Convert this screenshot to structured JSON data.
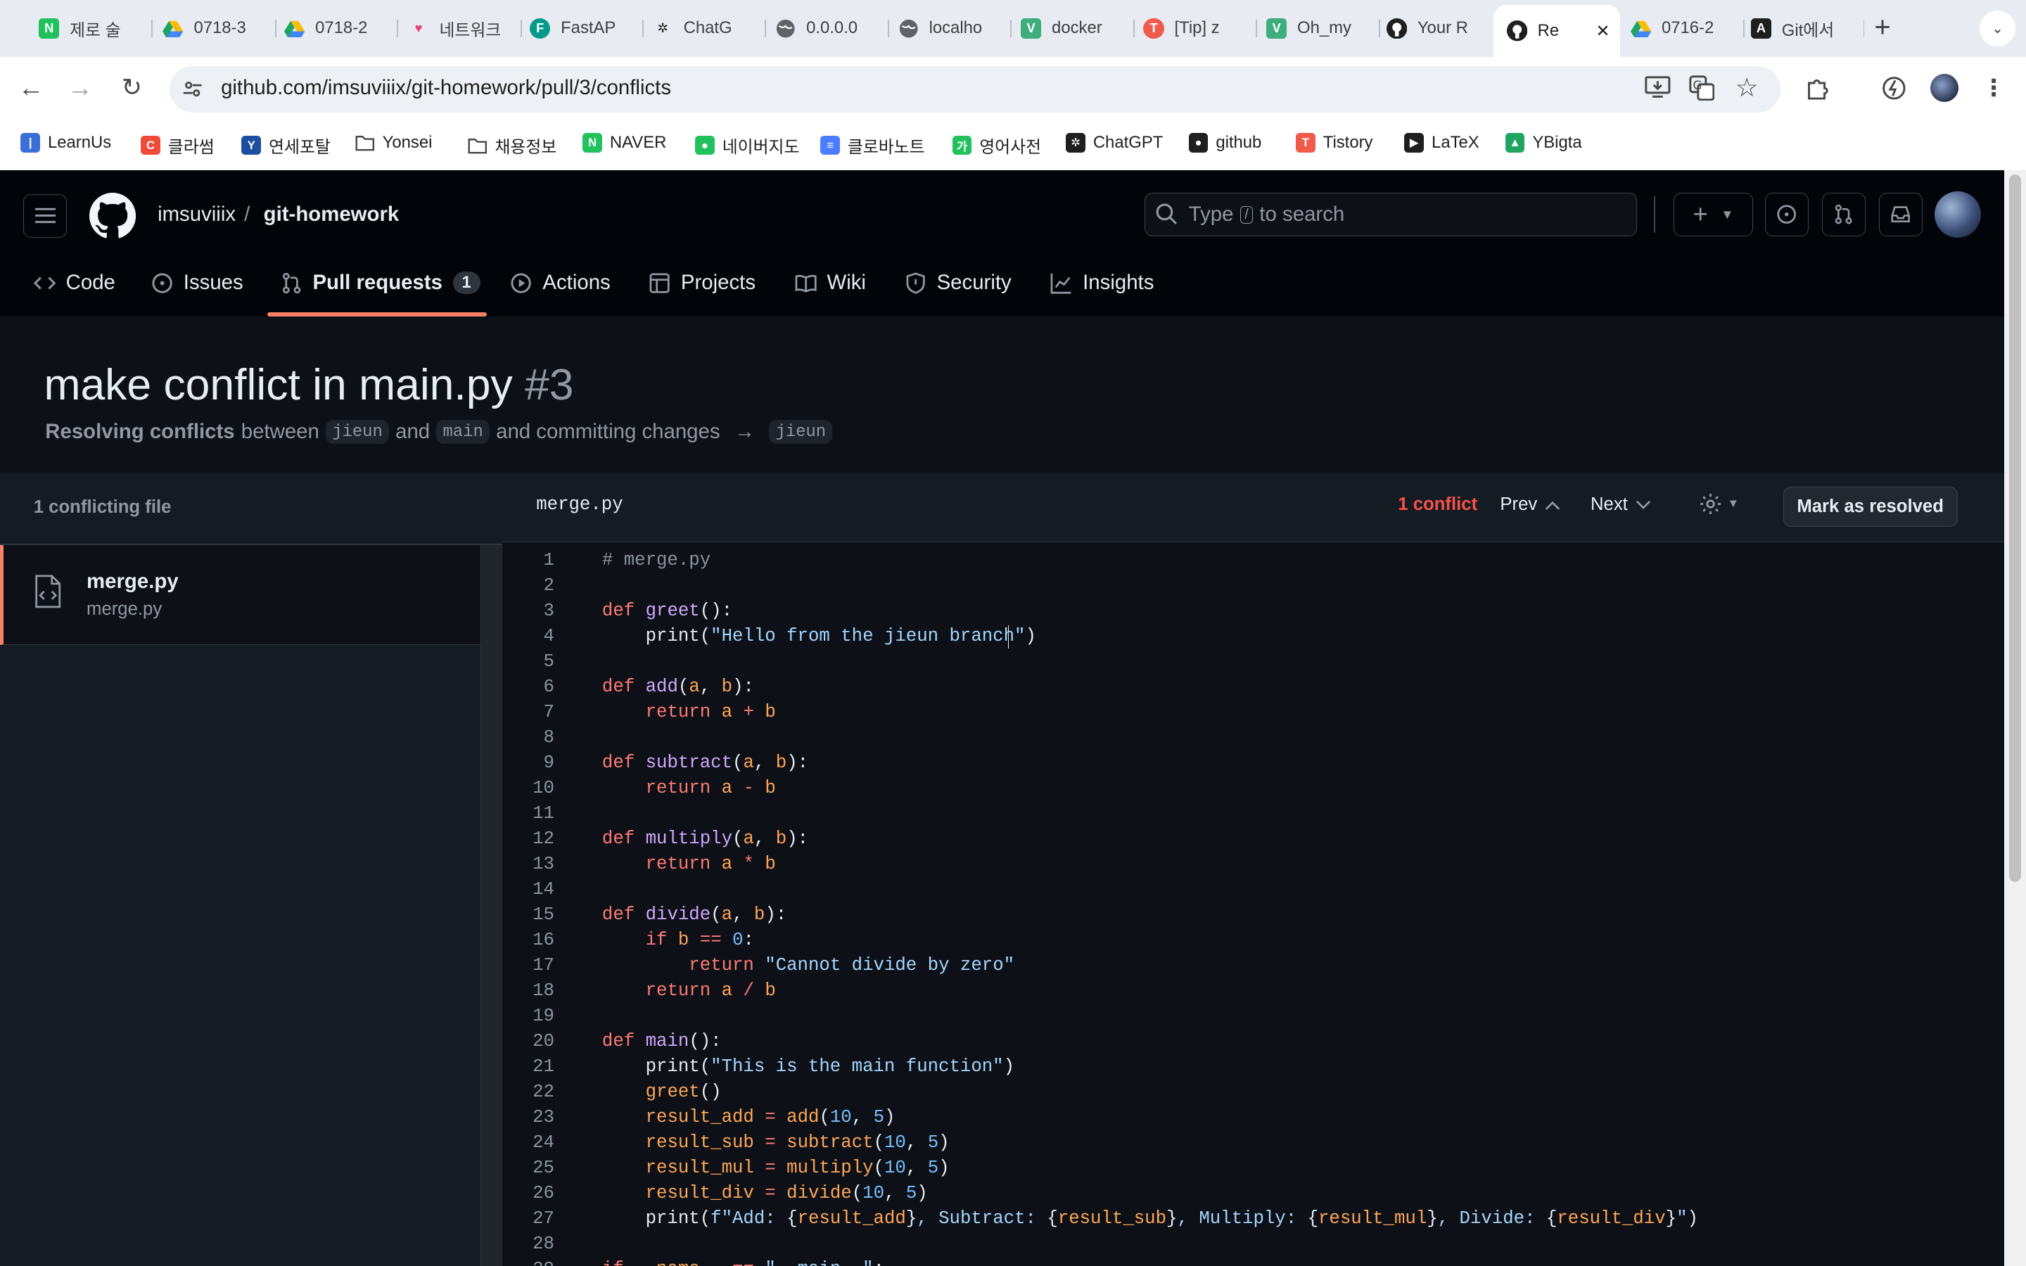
{
  "browser": {
    "tabs": [
      {
        "label": "제로 술",
        "favicon": "N",
        "color": "#21c25e"
      },
      {
        "label": "0718-3",
        "favicon": "drive",
        "color": "#1fa463"
      },
      {
        "label": "0718-2",
        "favicon": "drive",
        "color": "#1fa463"
      },
      {
        "label": "네트워크",
        "favicon": "heart",
        "color": "#e8407b"
      },
      {
        "label": "FastAP",
        "favicon": "F",
        "color": "#05998b"
      },
      {
        "label": "ChatG",
        "favicon": "gpt",
        "color": "#1f1f1f"
      },
      {
        "label": "0.0.0.0",
        "favicon": "globe",
        "color": "#5f6368"
      },
      {
        "label": "localho",
        "favicon": "globe",
        "color": "#5f6368"
      },
      {
        "label": "docker",
        "favicon": "V",
        "color": "#3eaf7c"
      },
      {
        "label": "[Tip] z",
        "favicon": "T",
        "color": "#f05a4a"
      },
      {
        "label": "Oh_my",
        "favicon": "V",
        "color": "#3eaf7c"
      },
      {
        "label": "Your R",
        "favicon": "gh",
        "color": "#1f1f1f"
      },
      {
        "label": "Re",
        "favicon": "gh",
        "color": "#1f1f1f",
        "active": true
      },
      {
        "label": "0716-2",
        "favicon": "drive",
        "color": "#1fa463"
      },
      {
        "label": "Git에서",
        "favicon": "A",
        "color": "#1f1f1f"
      }
    ],
    "url": "github.com/imsuviiix/git-homework/pull/3/conflicts",
    "bookmarks": [
      {
        "label": "LearnUs",
        "color": "#3b6fd8",
        "glyph": "|"
      },
      {
        "label": "클라썸",
        "color": "#f04a3a",
        "glyph": "C"
      },
      {
        "label": "연세포탈",
        "color": "#1d4fa0",
        "glyph": "Y"
      },
      {
        "label": "Yonsei",
        "color": "folder",
        "glyph": ""
      },
      {
        "label": "채용정보",
        "color": "folder",
        "glyph": ""
      },
      {
        "label": "NAVER",
        "color": "#21c25e",
        "glyph": "N"
      },
      {
        "label": "네이버지도",
        "color": "#21c25e",
        "glyph": "●"
      },
      {
        "label": "클로바노트",
        "color": "#4a7dff",
        "glyph": "≡"
      },
      {
        "label": "영어사전",
        "color": "#21c25e",
        "glyph": "가"
      },
      {
        "label": "ChatGPT",
        "color": "#1f1f1f",
        "glyph": "✲"
      },
      {
        "label": "github",
        "color": "#1f1f1f",
        "glyph": "●"
      },
      {
        "label": "Tistory",
        "color": "#f05a4a",
        "glyph": "T"
      },
      {
        "label": "LaTeX",
        "color": "#1f1f1f",
        "glyph": "▶"
      },
      {
        "label": "YBigta",
        "color": "#1fa463",
        "glyph": "▲"
      }
    ]
  },
  "repo": {
    "owner": "imsuviiix",
    "separator": "/",
    "name": "git-homework"
  },
  "search": {
    "prefix": "Type",
    "key": "/",
    "suffix": "to search"
  },
  "nav": [
    {
      "label": "Code",
      "icon": "code-icon"
    },
    {
      "label": "Issues",
      "icon": "issue-icon"
    },
    {
      "label": "Pull requests",
      "icon": "pull-request-icon",
      "count": "1",
      "active": true
    },
    {
      "label": "Actions",
      "icon": "play-icon"
    },
    {
      "label": "Projects",
      "icon": "table-icon"
    },
    {
      "label": "Wiki",
      "icon": "book-icon"
    },
    {
      "label": "Security",
      "icon": "shield-icon"
    },
    {
      "label": "Insights",
      "icon": "graph-icon"
    }
  ],
  "pr": {
    "title": "make conflict in main.py",
    "number": "#3",
    "sub_bold": "Resolving conflicts",
    "between": "between",
    "head": "jieun",
    "and": "and",
    "base": "main",
    "rest": "and committing changes",
    "arrow": "→",
    "target": "jieun"
  },
  "sidebar": {
    "heading": "1 conflicting file",
    "file": {
      "name": "merge.py",
      "path": "merge.py"
    }
  },
  "editor": {
    "filename": "merge.py",
    "conflicts": "1 conflict",
    "prev": "Prev",
    "next": "Next",
    "resolve": "Mark as resolved",
    "lines": [
      "# merge.py",
      "",
      "def greet():",
      "    print(\"Hello from the jieun branch\")",
      "",
      "def add(a, b):",
      "    return a + b",
      "",
      "def subtract(a, b):",
      "    return a - b",
      "",
      "def multiply(a, b):",
      "    return a * b",
      "",
      "def divide(a, b):",
      "    if b == 0:",
      "        return \"Cannot divide by zero\"",
      "    return a / b",
      "",
      "def main():",
      "    print(\"This is the main function\")",
      "    greet()",
      "    result_add = add(10, 5)",
      "    result_sub = subtract(10, 5)",
      "    result_mul = multiply(10, 5)",
      "    result_div = divide(10, 5)",
      "    print(f\"Add: {result_add}, Subtract: {result_sub}, Multiply: {result_mul}, Divide: {result_div}\")",
      "",
      "if __name__ == \"__main__\":"
    ]
  },
  "colors": {
    "accent": "#f78166",
    "danger": "#f85149",
    "bg": "#0d1117",
    "header": "#010409"
  }
}
